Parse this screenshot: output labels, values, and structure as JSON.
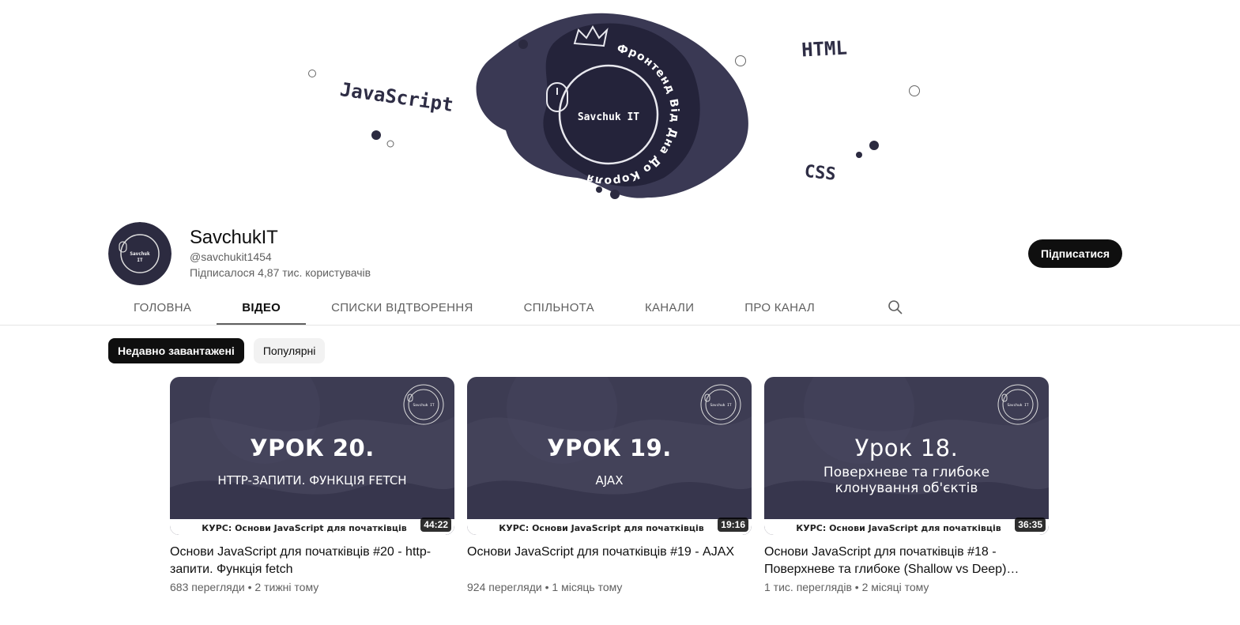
{
  "banner": {
    "center_text": "Savchuk IT",
    "arc_text": "Фронтенд Від Дна До Короля",
    "words": [
      "JavaScript",
      "HTML",
      "CSS"
    ]
  },
  "channel": {
    "name": "SavchukIT",
    "handle": "@savchukit1454",
    "subscribers": "Підписалося 4,87 тис. користувачів",
    "subscribe_label": "Підписатися"
  },
  "tabs": [
    {
      "label": "Головна",
      "active": false
    },
    {
      "label": "Відео",
      "active": true
    },
    {
      "label": "Списки відтворення",
      "active": false
    },
    {
      "label": "Спільнота",
      "active": false
    },
    {
      "label": "Канали",
      "active": false
    },
    {
      "label": "Про канал",
      "active": false
    }
  ],
  "chips": [
    {
      "label": "Недавно завантажені",
      "active": true
    },
    {
      "label": "Популярні",
      "active": false
    }
  ],
  "videos": [
    {
      "thumb_title": "УРОК 20.",
      "thumb_subtitle": "HTTP-ЗАПИТИ. ФУНКЦІЯ FETCH",
      "thumb_course": "КУРС: Основи JavaScript для початківців",
      "duration": "44:22",
      "title": "Основи JavaScript для початківців #20 - http-запити. Функція fetch",
      "meta": "683 перегляди • 2 тижні тому"
    },
    {
      "thumb_title": "УРОК 19.",
      "thumb_subtitle": "AJAX",
      "thumb_course": "КУРС: Основи JavaScript для початківців",
      "duration": "19:16",
      "title": "Основи JavaScript для початківців #19 - AJAX",
      "meta": "924 перегляди • 1 місяць тому"
    },
    {
      "thumb_title": "Урок 18.",
      "thumb_subtitle": "Поверхневе та глибоке клонування об'єктів",
      "thumb_course": "КУРС: Основи JavaScript для початківців",
      "duration": "36:35",
      "title": "Основи JavaScript для початківців #18 - Поверхневе та глибоке (Shallow vs Deep)…",
      "meta": "1 тис. переглядів • 2 місяці тому"
    }
  ],
  "colors": {
    "banner_blob": "#2e2d45",
    "thumb_bg": "#3c3b52",
    "accent": "#0f0f0f"
  }
}
